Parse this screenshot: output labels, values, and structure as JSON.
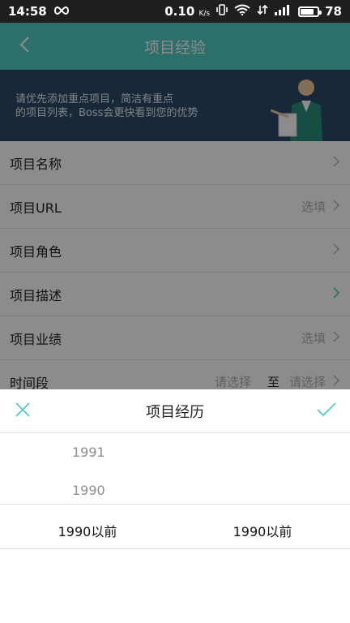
{
  "status_bar": {
    "time": "14:58",
    "infinity_icon": "infinity-icon",
    "speed_value": "0.10",
    "speed_unit": "K/s",
    "battery": "78",
    "battery_level": 0.78
  },
  "app_bar": {
    "title": "项目经验",
    "back_icon": "chevron-left-icon"
  },
  "banner": {
    "line1": "请优先添加重点项目，简洁有重点",
    "line2": "的项目列表，Boss会更快看到您的优势"
  },
  "form": {
    "rows": [
      {
        "label": "项目名称",
        "hint": ""
      },
      {
        "label": "项目URL",
        "hint": "选填"
      },
      {
        "label": "项目角色",
        "hint": ""
      },
      {
        "label": "项目描述",
        "hint": ""
      },
      {
        "label": "项目业绩",
        "hint": "选填"
      }
    ],
    "time_row": {
      "label": "时间段",
      "start_hint": "请选择",
      "to": "至",
      "end_hint": "请选择"
    }
  },
  "sheet": {
    "title": "项目经历",
    "close_icon": "close-icon",
    "confirm_icon": "check-icon",
    "picker": {
      "left": {
        "items": [
          "1991",
          "1990"
        ],
        "selected": "1990以前"
      },
      "right": {
        "items": [],
        "selected": "1990以前"
      }
    }
  },
  "colors": {
    "accent": "#53cac3",
    "banner": "#2f4a66",
    "status_bar": "#1f1f1f"
  }
}
